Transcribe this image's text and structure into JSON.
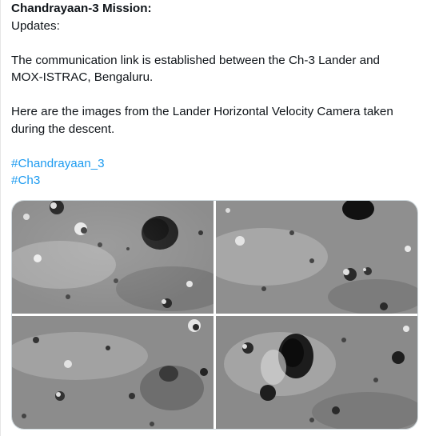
{
  "post": {
    "title": "Chandrayaan-3 Mission:",
    "subtitle": "Updates:",
    "para1_line1": "The communication link is established between the Ch-3 Lander and",
    "para1_line2": "MOX-ISTRAC, Bengaluru.",
    "para2_line1": "Here are the images from the Lander Horizontal Velocity Camera taken",
    "para2_line2": "during the descent.",
    "hashtags": [
      "#Chandrayaan_3",
      "#Ch3"
    ]
  },
  "media": {
    "images": [
      {
        "subject": "lunar-surface-descent-image-1"
      },
      {
        "subject": "lunar-surface-descent-image-2"
      },
      {
        "subject": "lunar-surface-descent-image-3"
      },
      {
        "subject": "lunar-surface-descent-image-4"
      }
    ]
  }
}
